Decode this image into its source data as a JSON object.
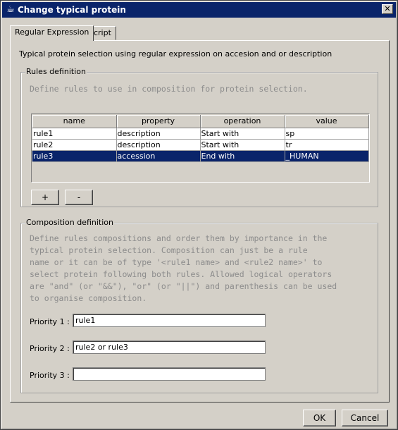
{
  "window": {
    "title": "Change typical protein",
    "close_glyph": "✕",
    "icon": "java-cup-icon"
  },
  "tabs": [
    {
      "label": "Regular Expression",
      "active": true
    },
    {
      "label": "Script",
      "active": false
    }
  ],
  "description": "Typical protein selection using regular expression on accesion and or description",
  "rules": {
    "legend": "Rules definition",
    "hint": "Define rules to use in composition for protein selection.",
    "columns": [
      "name",
      "property",
      "operation",
      "value"
    ],
    "rows": [
      {
        "name": "rule1",
        "property": "description",
        "operation": "Start with",
        "value": "sp"
      },
      {
        "name": "rule2",
        "property": "description",
        "operation": "Start with",
        "value": "tr"
      },
      {
        "name": "rule3",
        "property": "accession",
        "operation": "End with",
        "value": "_HUMAN"
      }
    ],
    "selected_row": 2,
    "add_label": "+",
    "remove_label": "-"
  },
  "composition": {
    "legend": "Composition definition",
    "hint_lines": [
      "Define rules compositions and order them by importance in the",
      "typical protein selection. Composition can just be a rule",
      "name or it can be of type '<rule1 name> and <rule2 name>' to",
      "select protein following both rules. Allowed logical operators",
      "are \"and\" (or \"&&\"), \"or\" (or \"||\") and parenthesis can be used",
      "to organise composition."
    ],
    "priorities": [
      {
        "label": "Priority 1 :",
        "value": "rule1"
      },
      {
        "label": "Priority 2 :",
        "value": "rule2 or rule3"
      },
      {
        "label": "Priority 3 :",
        "value": ""
      }
    ]
  },
  "footer": {
    "ok_label": "OK",
    "cancel_label": "Cancel"
  }
}
